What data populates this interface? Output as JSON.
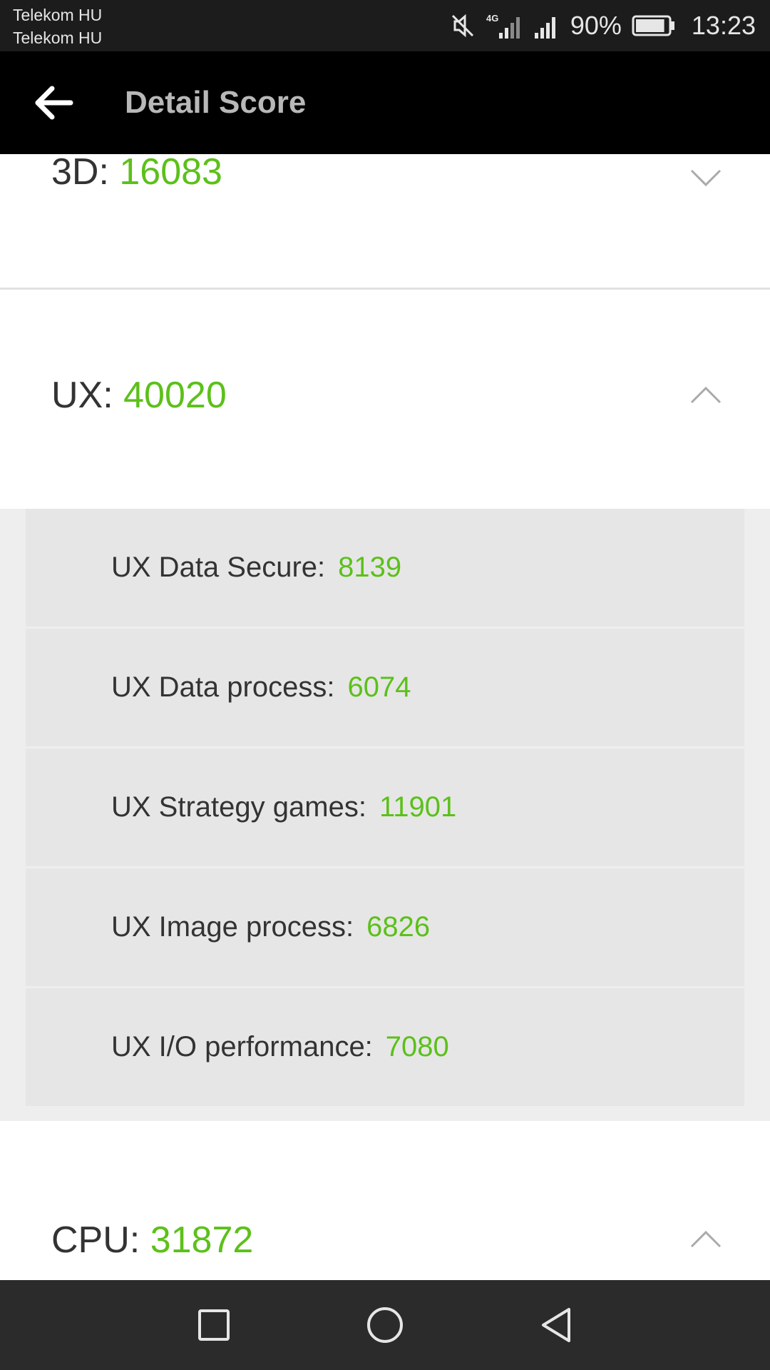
{
  "status_bar": {
    "carrier_1": "Telekom HU",
    "carrier_2": "Telekom HU",
    "icons": [
      "mute-icon",
      "signal-4g-icon",
      "signal-icon",
      "battery-icon"
    ],
    "battery_percent": "90%",
    "battery_level": 0.9,
    "time": "13:23"
  },
  "app_bar": {
    "title": "Detail Score",
    "back_icon": "arrow-left-icon"
  },
  "sections": [
    {
      "label": "3D:",
      "score": "16083",
      "state": "collapsed",
      "icon": "chevron-down-icon"
    },
    {
      "label": "UX:",
      "score": "40020",
      "state": "expanded",
      "icon": "chevron-up-icon"
    },
    {
      "label": "CPU:",
      "score": "31872",
      "state": "expanded",
      "icon": "chevron-up-icon"
    }
  ],
  "ux_details": [
    {
      "label": "UX Data Secure:",
      "score": "8139"
    },
    {
      "label": "UX Data process:",
      "score": "6074"
    },
    {
      "label": "UX Strategy games:",
      "score": "11901"
    },
    {
      "label": "UX Image process:",
      "score": "6826"
    },
    {
      "label": "UX I/O performance:",
      "score": "7080"
    }
  ],
  "nav_bar": {
    "buttons": [
      "recents-square-icon",
      "home-circle-icon",
      "back-triangle-icon"
    ]
  },
  "colors": {
    "score_green": "#5cc01a",
    "status_bar_bg": "#1c1c1c",
    "app_bar_bg": "#000000",
    "title_gray": "#b8b8b8",
    "nav_bar_bg": "#2b2b2b"
  }
}
